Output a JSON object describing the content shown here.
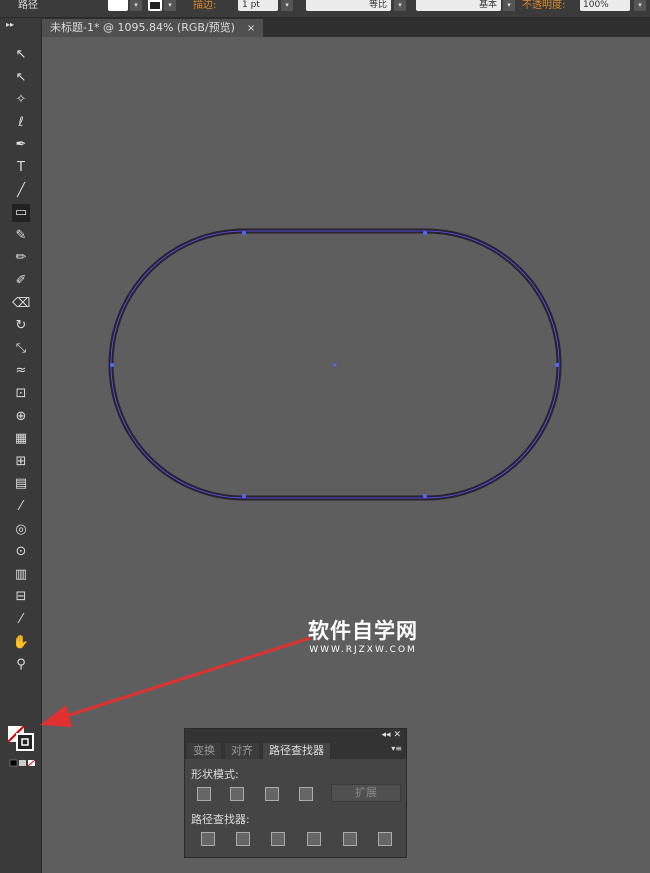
{
  "control_bar": {
    "object_type": "路径",
    "stroke_label": "描边:",
    "stroke_weight": "1 pt",
    "profile": "等比",
    "brush": "基本",
    "opacity_label": "不透明度:",
    "opacity": "100%"
  },
  "document_tab": {
    "title": "未标题-1* @ 1095.84% (RGB/预览)",
    "close": "×"
  },
  "tools": [
    "selection",
    "direct-selection",
    "magic-wand",
    "lasso",
    "pen",
    "type",
    "line",
    "rounded-rectangle",
    "paintbrush",
    "pencil",
    "blob-brush",
    "eraser",
    "rotate",
    "scale",
    "warp",
    "free-transform",
    "shape-builder",
    "perspective-grid",
    "mesh",
    "gradient",
    "eyedropper",
    "blend",
    "symbol-sprayer",
    "column-graph",
    "artboard",
    "slice",
    "hand",
    "zoom"
  ],
  "watermark": {
    "title": "软件自学网",
    "url": "WWW.RJZXW.COM"
  },
  "colors": {
    "canvas": "#5e5e5e",
    "path_stroke": "#2b2230",
    "anchor": "#4a6cff",
    "arrow": "#e03030"
  },
  "pathfinder_panel": {
    "tabs": [
      "变换",
      "对齐",
      "路径查找器"
    ],
    "active_tab": 2,
    "shape_modes_label": "形状模式:",
    "expand_label": "扩展",
    "pathfinders_label": "路径查找器:",
    "collapse": "◂◂",
    "close": "✕",
    "menu": "▾≡"
  }
}
